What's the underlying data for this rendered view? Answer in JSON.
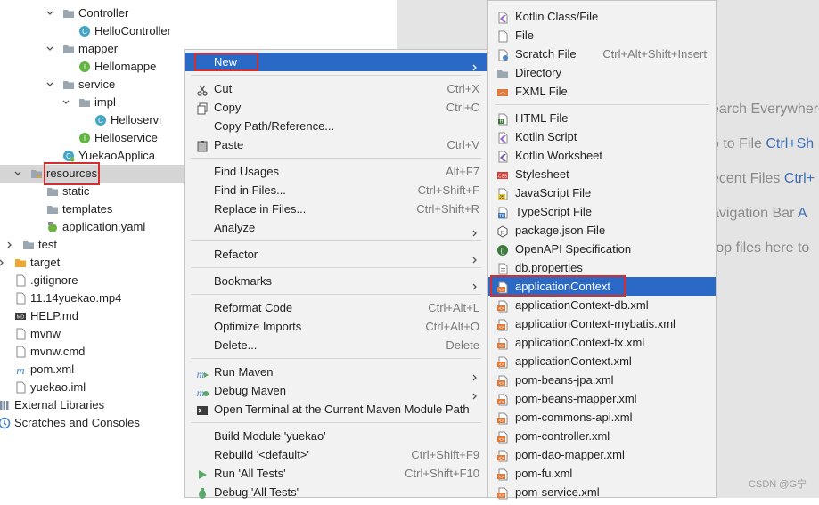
{
  "tree": {
    "items": [
      {
        "label": "Controller",
        "icon": "folder-icon",
        "depth": 3,
        "arrow": "down"
      },
      {
        "label": "HelloController",
        "icon": "class-icon",
        "depth": 4,
        "arrow": ""
      },
      {
        "label": "mapper",
        "icon": "folder-icon",
        "depth": 3,
        "arrow": "down"
      },
      {
        "label": "Hellomappe",
        "icon": "interface-icon",
        "depth": 4,
        "arrow": ""
      },
      {
        "label": "service",
        "icon": "folder-icon",
        "depth": 3,
        "arrow": "down"
      },
      {
        "label": "impl",
        "icon": "folder-icon",
        "depth": 4,
        "arrow": "down"
      },
      {
        "label": "Helloservi",
        "icon": "class-icon",
        "depth": 5,
        "arrow": ""
      },
      {
        "label": "Helloservice",
        "icon": "interface-icon",
        "depth": 4,
        "arrow": ""
      },
      {
        "label": "YuekaoApplica",
        "icon": "spring-class-icon",
        "depth": 3,
        "arrow": ""
      },
      {
        "label": "resources",
        "icon": "resources-folder-icon",
        "depth": 1,
        "arrow": "down",
        "selected": true,
        "boxed": true
      },
      {
        "label": "static",
        "icon": "folder-icon",
        "depth": 2,
        "arrow": ""
      },
      {
        "label": "templates",
        "icon": "folder-icon",
        "depth": 2,
        "arrow": ""
      },
      {
        "label": "application.yaml",
        "icon": "yaml-icon",
        "depth": 2,
        "arrow": ""
      },
      {
        "label": "test",
        "icon": "folder-icon",
        "depth": 0.5,
        "arrow": "right"
      },
      {
        "label": "target",
        "icon": "orange-folder-icon",
        "depth": 0,
        "arrow": "right"
      },
      {
        "label": ".gitignore",
        "icon": "file-icon",
        "depth": 0,
        "arrow": ""
      },
      {
        "label": "11.14yuekao.mp4",
        "icon": "file-icon",
        "depth": 0,
        "arrow": ""
      },
      {
        "label": "HELP.md",
        "icon": "markdown-icon",
        "depth": 0,
        "arrow": ""
      },
      {
        "label": "mvnw",
        "icon": "file-icon",
        "depth": 0,
        "arrow": ""
      },
      {
        "label": "mvnw.cmd",
        "icon": "file-icon",
        "depth": 0,
        "arrow": ""
      },
      {
        "label": "pom.xml",
        "icon": "maven-icon",
        "depth": 0,
        "arrow": ""
      },
      {
        "label": "yuekao.iml",
        "icon": "file-icon",
        "depth": 0,
        "arrow": ""
      },
      {
        "label": "External Libraries",
        "icon": "library-icon",
        "depth": -1,
        "arrow": "right"
      },
      {
        "label": "Scratches and Consoles",
        "icon": "scratch-icon",
        "depth": -1,
        "arrow": ""
      }
    ]
  },
  "hints": [
    {
      "text": "earch Everywhere",
      "key": ""
    },
    {
      "text": "o to File ",
      "key": "Ctrl+Sh"
    },
    {
      "text": "ecent Files ",
      "key": "Ctrl+"
    },
    {
      "text": "avigation Bar ",
      "key": "A"
    },
    {
      "text": "rop files here to",
      "key": ""
    }
  ],
  "context_menu": {
    "items": [
      {
        "label": "New",
        "shortcut": "",
        "submenu": true,
        "icon": "",
        "active": true,
        "sep_after": true
      },
      {
        "label": "Cut",
        "shortcut": "Ctrl+X",
        "icon": "scissors-icon"
      },
      {
        "label": "Copy",
        "shortcut": "Ctrl+C",
        "icon": "copy-icon"
      },
      {
        "label": "Copy Path/Reference...",
        "shortcut": "",
        "icon": ""
      },
      {
        "label": "Paste",
        "shortcut": "Ctrl+V",
        "icon": "paste-icon",
        "sep_after": true
      },
      {
        "label": "Find Usages",
        "shortcut": "Alt+F7",
        "icon": ""
      },
      {
        "label": "Find in Files...",
        "shortcut": "Ctrl+Shift+F",
        "icon": ""
      },
      {
        "label": "Replace in Files...",
        "shortcut": "Ctrl+Shift+R",
        "icon": ""
      },
      {
        "label": "Analyze",
        "shortcut": "",
        "submenu": true,
        "icon": "",
        "sep_after": true
      },
      {
        "label": "Refactor",
        "shortcut": "",
        "submenu": true,
        "icon": "",
        "sep_after": true
      },
      {
        "label": "Bookmarks",
        "shortcut": "",
        "submenu": true,
        "icon": "",
        "sep_after": true
      },
      {
        "label": "Reformat Code",
        "shortcut": "Ctrl+Alt+L",
        "icon": ""
      },
      {
        "label": "Optimize Imports",
        "shortcut": "Ctrl+Alt+O",
        "icon": ""
      },
      {
        "label": "Delete...",
        "shortcut": "Delete",
        "icon": "",
        "sep_after": true
      },
      {
        "label": "Run Maven",
        "shortcut": "",
        "submenu": true,
        "icon": "maven-run-icon"
      },
      {
        "label": "Debug Maven",
        "shortcut": "",
        "submenu": true,
        "icon": "maven-debug-icon"
      },
      {
        "label": "Open Terminal at the Current Maven Module Path",
        "shortcut": "",
        "icon": "terminal-icon",
        "sep_after": true
      },
      {
        "label": "Build Module 'yuekao'",
        "shortcut": "",
        "icon": ""
      },
      {
        "label": "Rebuild '<default>'",
        "shortcut": "Ctrl+Shift+F9",
        "icon": ""
      },
      {
        "label": "Run 'All Tests'",
        "shortcut": "Ctrl+Shift+F10",
        "icon": "run-icon"
      },
      {
        "label": "Debug 'All Tests'",
        "shortcut": "",
        "icon": "debug-icon"
      }
    ]
  },
  "new_submenu": {
    "items": [
      {
        "label": "Kotlin Class/File",
        "shortcut": "",
        "icon": "kotlin-file-icon"
      },
      {
        "label": "File",
        "shortcut": "",
        "icon": "file-icon"
      },
      {
        "label": "Scratch File",
        "shortcut": "Ctrl+Alt+Shift+Insert",
        "icon": "scratch-file-icon"
      },
      {
        "label": "Directory",
        "shortcut": "",
        "icon": "folder-icon"
      },
      {
        "label": "FXML File",
        "shortcut": "",
        "icon": "fxml-icon",
        "sep_after": true
      },
      {
        "label": "HTML File",
        "shortcut": "",
        "icon": "html-icon"
      },
      {
        "label": "Kotlin Script",
        "shortcut": "",
        "icon": "kotlin-script-icon"
      },
      {
        "label": "Kotlin Worksheet",
        "shortcut": "",
        "icon": "kotlin-worksheet-icon"
      },
      {
        "label": "Stylesheet",
        "shortcut": "",
        "icon": "css-icon"
      },
      {
        "label": "JavaScript File",
        "shortcut": "",
        "icon": "js-icon"
      },
      {
        "label": "TypeScript File",
        "shortcut": "",
        "icon": "ts-icon"
      },
      {
        "label": "package.json File",
        "shortcut": "",
        "icon": "npm-icon"
      },
      {
        "label": "OpenAPI Specification",
        "shortcut": "",
        "icon": "openapi-icon"
      },
      {
        "label": "db.properties",
        "shortcut": "",
        "icon": "template-file-icon"
      },
      {
        "label": "applicationContext",
        "shortcut": "",
        "icon": "xml-template-icon",
        "active": true
      },
      {
        "label": "applicationContext-db.xml",
        "shortcut": "",
        "icon": "xml-template-icon"
      },
      {
        "label": "applicationContext-mybatis.xml",
        "shortcut": "",
        "icon": "xml-template-icon"
      },
      {
        "label": "applicationContext-tx.xml",
        "shortcut": "",
        "icon": "xml-template-icon"
      },
      {
        "label": "applicationContext.xml",
        "shortcut": "",
        "icon": "xml-template-icon"
      },
      {
        "label": "pom-beans-jpa.xml",
        "shortcut": "",
        "icon": "xml-template-icon"
      },
      {
        "label": "pom-beans-mapper.xml",
        "shortcut": "",
        "icon": "xml-template-icon"
      },
      {
        "label": "pom-commons-api.xml",
        "shortcut": "",
        "icon": "xml-template-icon"
      },
      {
        "label": "pom-controller.xml",
        "shortcut": "",
        "icon": "xml-template-icon"
      },
      {
        "label": "pom-dao-mapper.xml",
        "shortcut": "",
        "icon": "xml-template-icon"
      },
      {
        "label": "pom-fu.xml",
        "shortcut": "",
        "icon": "xml-template-icon"
      },
      {
        "label": "pom-service.xml",
        "shortcut": "",
        "icon": "xml-template-icon"
      }
    ]
  },
  "watermark": "CSDN @G宁",
  "colors": {
    "accent": "#2a69c5",
    "highlight_box": "#d32f2f",
    "editor_bg": "#e4e4e4",
    "menu_bg": "#f2f2f2"
  }
}
